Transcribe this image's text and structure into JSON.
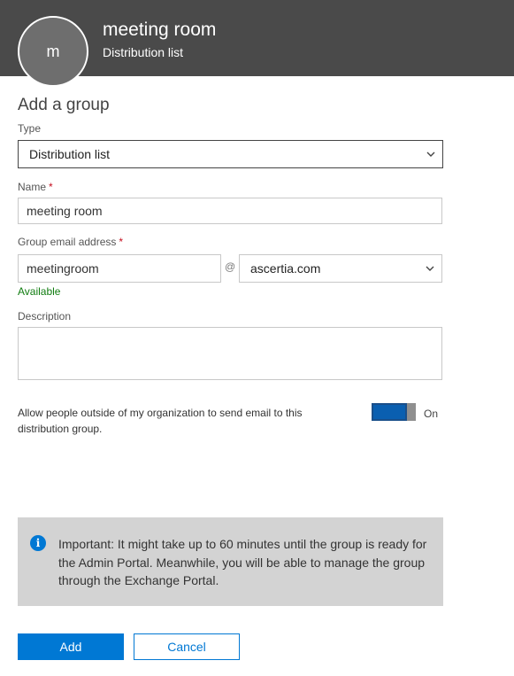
{
  "header": {
    "avatar_initial": "m",
    "title": "meeting room",
    "subtitle": "Distribution list"
  },
  "form": {
    "title": "Add a group",
    "type": {
      "label": "Type",
      "value": "Distribution list"
    },
    "name": {
      "label": "Name",
      "required_mark": "*",
      "value": "meeting room"
    },
    "email": {
      "label": "Group email address",
      "required_mark": "*",
      "alias_value": "meetingroom",
      "at_symbol": "@",
      "domain_value": "ascertia.com",
      "availability": "Available"
    },
    "description": {
      "label": "Description",
      "value": ""
    },
    "external_email": {
      "label": "Allow people outside of my organization to send email to this distribution group.",
      "toggle_state": "On"
    }
  },
  "info_banner": {
    "icon": "info-icon",
    "text": "Important: It might take up to 60 minutes until the group is ready for the Admin Portal. Meanwhile, you will be able to manage the group through the Exchange Portal."
  },
  "actions": {
    "add_label": "Add",
    "cancel_label": "Cancel"
  },
  "colors": {
    "header_bg": "#4a4a4a",
    "accent": "#0078d4",
    "available": "#107c10",
    "required": "#c50f1f",
    "info_bg": "#d3d3d3"
  }
}
